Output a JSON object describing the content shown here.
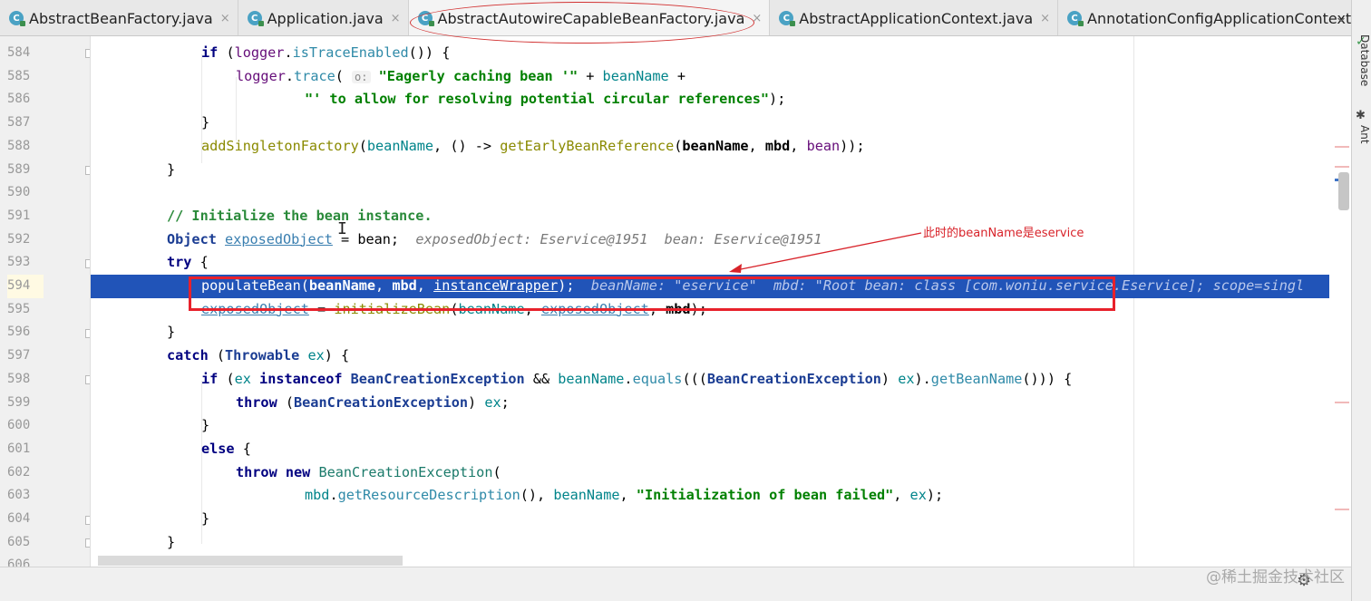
{
  "tabs": [
    {
      "label": "AbstractBeanFactory.java",
      "close": "×",
      "icon_letter": "C",
      "active": false
    },
    {
      "label": "Application.java",
      "close": "×",
      "icon_letter": "C",
      "active": false
    },
    {
      "label": "AbstractAutowireCapableBeanFactory.java",
      "close": "×",
      "icon_letter": "C",
      "active": true
    },
    {
      "label": "AbstractApplicationContext.java",
      "close": "×",
      "icon_letter": "C",
      "active": false
    },
    {
      "label": "AnnotationConfigApplicationContext.",
      "close": "",
      "icon_letter": "C",
      "active": false
    }
  ],
  "tab_overflow": "⌄",
  "right_tools": {
    "database": "Database",
    "ant": "Ant"
  },
  "editor": {
    "line_numbers": [
      "584",
      "585",
      "586",
      "587",
      "588",
      "589",
      "590",
      "591",
      "592",
      "593",
      "594",
      "595",
      "596",
      "597",
      "598",
      "599",
      "600",
      "601",
      "602",
      "603",
      "604",
      "605",
      "606"
    ],
    "execution_line": "594",
    "line_584": {
      "a": "if",
      "b": " (",
      "c": "logger",
      "d": ".",
      "e": "isTraceEnabled",
      "f": "()) {"
    },
    "line_585": {
      "a": "logger",
      "b": ".",
      "c": "trace",
      "d": "( ",
      "hint": "o:",
      "e": " ",
      "f": "\"Eagerly caching bean '\"",
      "g": " + ",
      "h": "beanName",
      "i": " +"
    },
    "line_586": {
      "a": "\"' to allow for resolving potential circular references\"",
      "b": ");"
    },
    "line_587": {
      "a": "}"
    },
    "line_588": {
      "a": "addSingletonFactory",
      "b": "(",
      "c": "beanName",
      "d": ", () -> ",
      "e": "getEarlyBeanReference",
      "f": "(",
      "g": "beanName",
      "h": ", ",
      "i": "mbd",
      "j": ", ",
      "k": "bean",
      "l": "));"
    },
    "line_589": {
      "a": "}"
    },
    "line_591": {
      "a": "// Initialize the bean instance."
    },
    "line_592": {
      "a": "Object",
      "b": " ",
      "c": "exposedObject",
      "d": " = bean;",
      "hint": "  exposedObject: Eservice@1951  bean: Eservice@1951"
    },
    "line_593": {
      "a": "try",
      "b": " {"
    },
    "line_594": {
      "a": "populateBean(",
      "b": "beanName",
      "c": ", ",
      "d": "mbd",
      "e": ", ",
      "f": "instanceWrapper",
      "g": ");",
      "hint": "  beanName: \"eservice\"  mbd: \"Root bean: class [com.woniu.service.Eservice]; scope=singl"
    },
    "line_595": {
      "a": "exposedObject",
      "b": " = ",
      "c": "initializeBean",
      "d": "(",
      "e": "beanName",
      "f": ", ",
      "g": "exposedObject",
      "h": ", ",
      "i": "mbd",
      "j": ");"
    },
    "line_596": {
      "a": "}"
    },
    "line_597": {
      "a": "catch",
      "b": " (",
      "c": "Throwable",
      "d": " ",
      "e": "ex",
      "f": ") {"
    },
    "line_598": {
      "a": "if",
      "b": " (",
      "c": "ex",
      "d": " ",
      "e": "instanceof",
      "f": " ",
      "g": "BeanCreationException",
      "h": " && ",
      "i": "beanName",
      "j": ".",
      "k": "equals",
      "l": "(((",
      "m": "BeanCreationException",
      "n": ") ",
      "o": "ex",
      "p": ").",
      "q": "getBeanName",
      "r": "())) {"
    },
    "line_599": {
      "a": "throw",
      "b": " (",
      "c": "BeanCreationException",
      "d": ") ",
      "e": "ex",
      "f": ";"
    },
    "line_600": {
      "a": "}"
    },
    "line_601": {
      "a": "else",
      "b": " {"
    },
    "line_602": {
      "a": "throw new",
      "b": " ",
      "c": "BeanCreationException",
      "d": "("
    },
    "line_603": {
      "a": "mbd",
      "b": ".",
      "c": "getResourceDescription",
      "d": "(), ",
      "e": "beanName",
      "f": ", ",
      "g": "\"Initialization of bean failed\"",
      "h": ", ",
      "i": "ex",
      "j": ");"
    },
    "line_604": {
      "a": "}"
    },
    "line_605": {
      "a": "}"
    }
  },
  "annotation": {
    "text": "此时的beanName是eservice",
    "color": "#e8212b"
  },
  "watermark": "@稀土掘金技术社区",
  "colors": {
    "execution_highlight": "#2154b8",
    "keyword": "#000080",
    "string": "#008000",
    "field": "#660e7a"
  }
}
